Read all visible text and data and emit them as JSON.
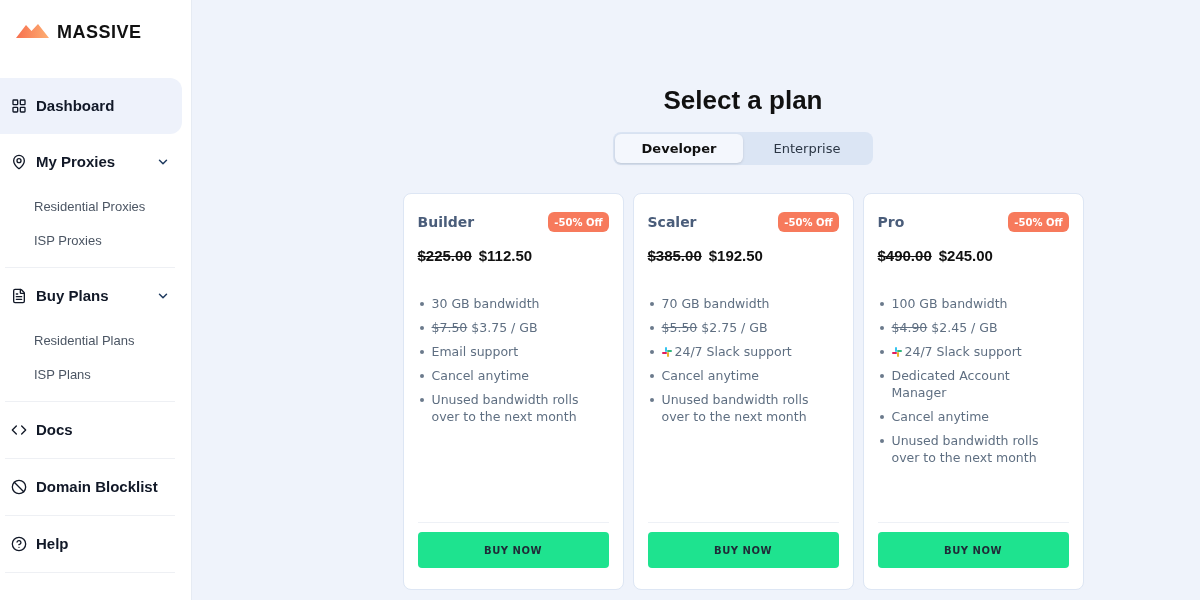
{
  "sidebar": {
    "logo": {
      "text": "MASSIVE"
    },
    "items": [
      {
        "kind": "link",
        "label": "Dashboard",
        "selected": true
      },
      {
        "kind": "group",
        "label": "My Proxies",
        "selected": false,
        "expanded": true,
        "children": [
          {
            "label": "Residential Proxies",
            "selected": false
          },
          {
            "label": "ISP Proxies",
            "selected": false
          }
        ]
      },
      {
        "kind": "group",
        "label": "Buy Plans",
        "selected": false,
        "expanded": true,
        "children": [
          {
            "label": "Residential Plans",
            "selected": false
          },
          {
            "label": "ISP Plans",
            "selected": false
          }
        ]
      },
      {
        "kind": "link",
        "label": "Docs",
        "selected": false
      },
      {
        "kind": "link",
        "label": "Domain Blocklist",
        "selected": false
      },
      {
        "kind": "link",
        "label": "Help",
        "selected": false
      }
    ]
  },
  "main": {
    "title": "Select a plan",
    "tabs": [
      {
        "label": "Developer",
        "selected": true
      },
      {
        "label": "Enterprise",
        "selected": false
      }
    ],
    "plans": [
      {
        "name": "Builder",
        "badge": "-50% Off",
        "old_price": "$225.00",
        "price": "$112.50",
        "features": [
          {
            "kind": "plain",
            "text": "30 GB bandwidth"
          },
          {
            "kind": "per_gb",
            "old": "$7.50",
            "text": "$3.75 / GB"
          },
          {
            "kind": "plain",
            "text": "Email support"
          },
          {
            "kind": "plain",
            "text": "Cancel anytime"
          },
          {
            "kind": "plain",
            "text": "Unused bandwidth rolls over to the next month"
          }
        ],
        "button": "BUY NOW"
      },
      {
        "name": "Scaler",
        "badge": "-50% Off",
        "old_price": "$385.00",
        "price": "$192.50",
        "features": [
          {
            "kind": "plain",
            "text": "70 GB bandwidth"
          },
          {
            "kind": "per_gb",
            "old": "$5.50",
            "text": "$2.75 / GB"
          },
          {
            "kind": "slack",
            "text": "24/7 Slack support"
          },
          {
            "kind": "plain",
            "text": "Cancel anytime"
          },
          {
            "kind": "plain",
            "text": "Unused bandwidth rolls over to the next month"
          }
        ],
        "button": "BUY NOW"
      },
      {
        "name": "Pro",
        "badge": "-50% Off",
        "old_price": "$490.00",
        "price": "$245.00",
        "features": [
          {
            "kind": "plain",
            "text": "100 GB bandwidth"
          },
          {
            "kind": "per_gb",
            "old": "$4.90",
            "text": "$2.45 / GB"
          },
          {
            "kind": "slack",
            "text": "24/7 Slack support"
          },
          {
            "kind": "plain",
            "text": "Dedicated Account Manager"
          },
          {
            "kind": "plain",
            "text": "Cancel anytime"
          },
          {
            "kind": "plain",
            "text": "Unused bandwidth rolls over to the next month"
          }
        ],
        "button": "BUY NOW"
      }
    ]
  }
}
